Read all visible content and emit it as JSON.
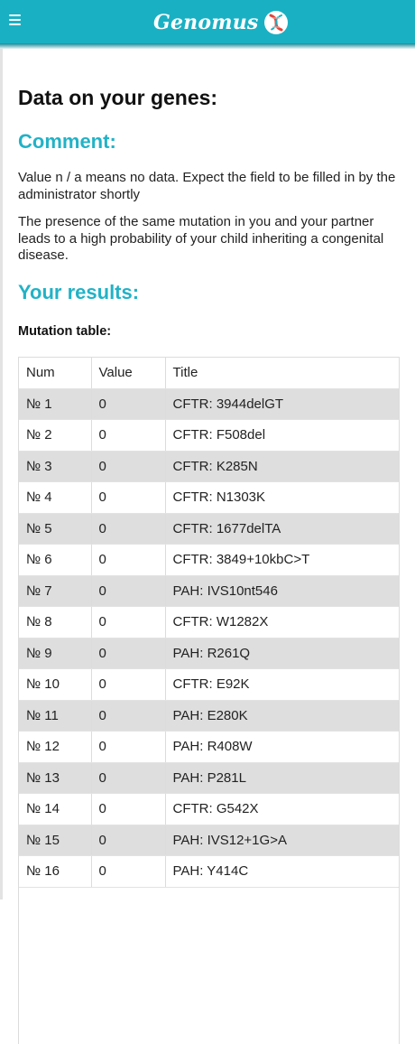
{
  "app": {
    "title": "Genomus"
  },
  "page": {
    "title": "Data on your genes:",
    "comment_heading": "Comment:",
    "comment_paragraphs": [
      "Value n / a means no data. Expect the field to be filled in by the administrator shortly",
      "The presence of the same mutation in you and your partner leads to a high probability of your child inheriting a congenital disease."
    ],
    "results_heading": "Your results:",
    "table_title": "Mutation table:"
  },
  "colors": {
    "accent": "#1ab0c3",
    "heading": "#22b2c6",
    "row_stripe": "#dedede"
  },
  "table": {
    "headers": [
      "Num",
      "Value",
      "Title"
    ],
    "rows": [
      [
        "№ 1",
        "0",
        "CFTR: 3944delGT"
      ],
      [
        "№ 2",
        "0",
        "CFTR: F508del"
      ],
      [
        "№ 3",
        "0",
        "CFTR: K285N"
      ],
      [
        "№ 4",
        "0",
        "CFTR: N1303K"
      ],
      [
        "№ 5",
        "0",
        "CFTR: 1677delTA"
      ],
      [
        "№ 6",
        "0",
        "CFTR: 3849+10kbC>T"
      ],
      [
        "№ 7",
        "0",
        "PAH: IVS10nt546"
      ],
      [
        "№ 8",
        "0",
        "CFTR: W1282X"
      ],
      [
        "№ 9",
        "0",
        "PAH: R261Q"
      ],
      [
        "№ 10",
        "0",
        "CFTR: E92K"
      ],
      [
        "№ 11",
        "0",
        "PAH: E280K"
      ],
      [
        "№ 12",
        "0",
        "PAH: R408W"
      ],
      [
        "№ 13",
        "0",
        "PAH: P281L"
      ],
      [
        "№ 14",
        "0",
        "CFTR: G542X"
      ],
      [
        "№ 15",
        "0",
        "PAH: IVS12+1G>A"
      ],
      [
        "№ 16",
        "0",
        "PAH: Y414C"
      ]
    ]
  }
}
